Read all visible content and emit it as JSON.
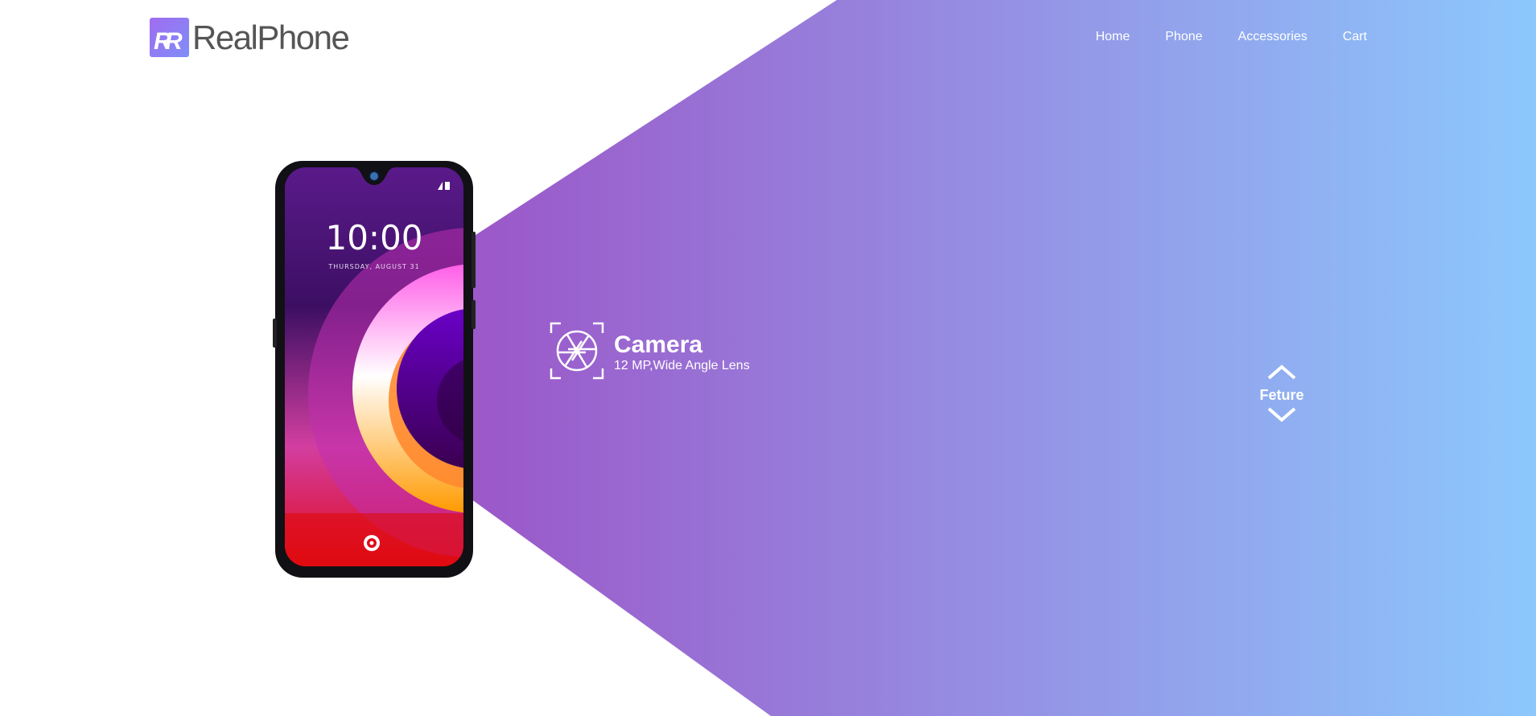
{
  "brand": {
    "name": "RealPhone",
    "logo_icon": "rr-logo-icon"
  },
  "nav": {
    "items": [
      {
        "label": "Home"
      },
      {
        "label": "Phone"
      },
      {
        "label": "Accessories"
      },
      {
        "label": "Cart"
      }
    ]
  },
  "phone": {
    "time": "10:00",
    "date": "THURSDAY, AUGUST 31"
  },
  "feature": {
    "icon": "camera-aperture-icon",
    "title": "Camera",
    "description": "12 MP,Wide Angle Lens"
  },
  "feature_nav": {
    "label": "Feture",
    "up_icon": "chevron-up-icon",
    "down_icon": "chevron-down-icon"
  },
  "colors": {
    "gradient_start": "#9b59c9",
    "gradient_end": "#8cc8fc",
    "logo_text": "#555555"
  }
}
